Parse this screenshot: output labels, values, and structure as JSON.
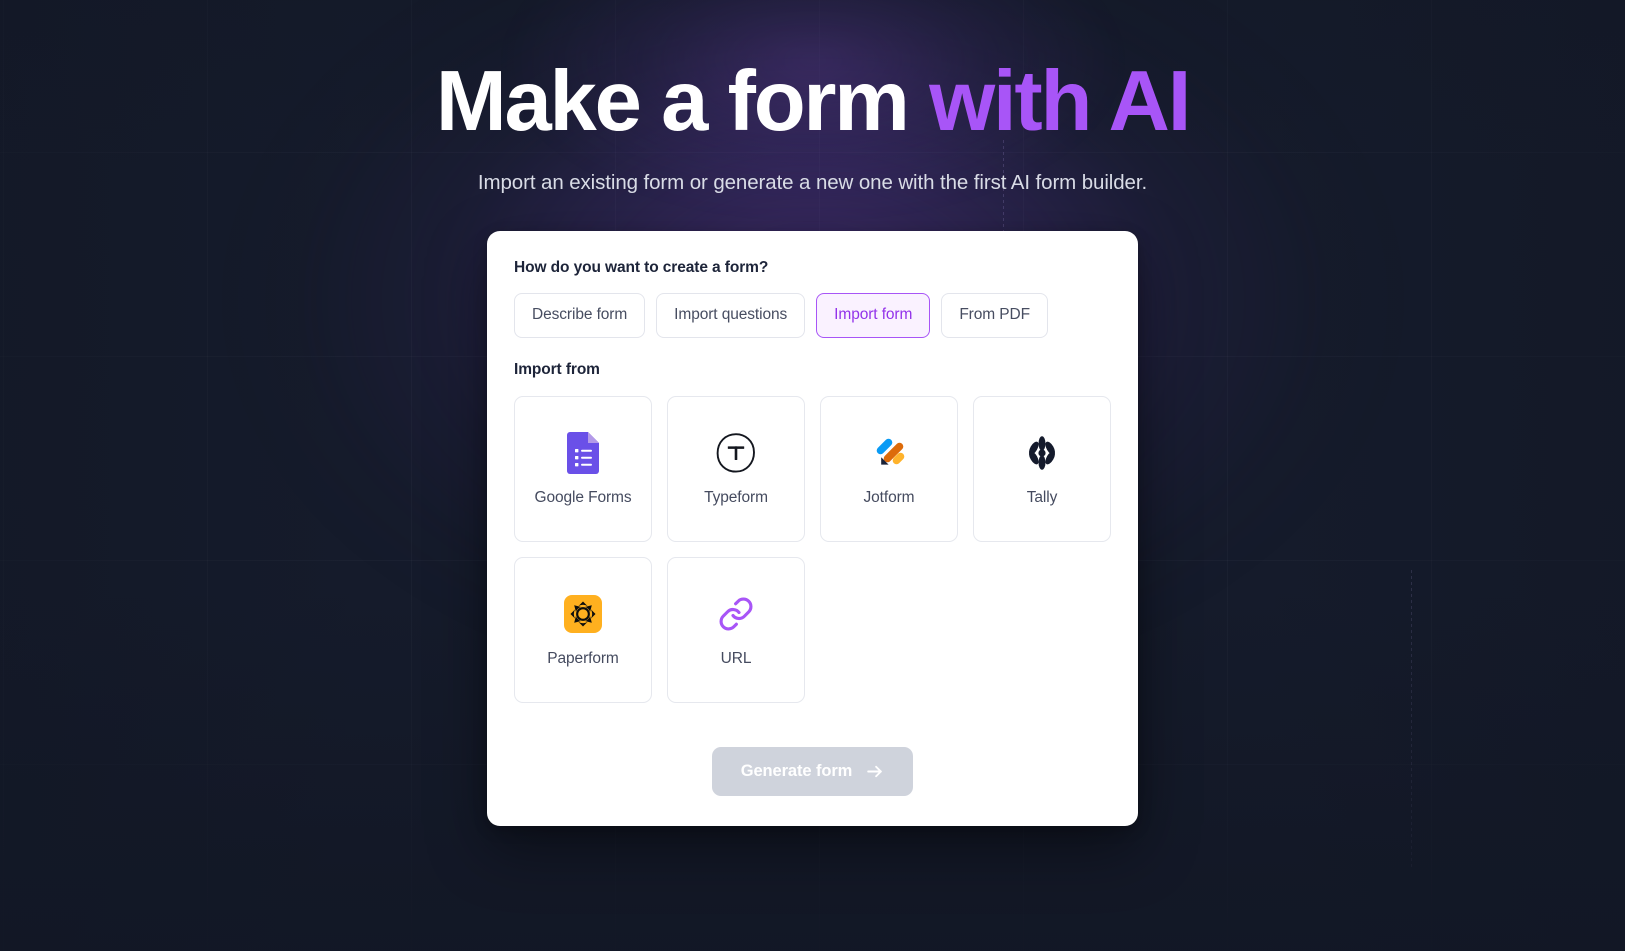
{
  "hero": {
    "headline_prefix": "Make a form ",
    "headline_accent": "with AI",
    "subtitle": "Import an existing form or generate a new one with the first AI form builder."
  },
  "card": {
    "mode_question": "How do you want to create a form?",
    "mode_tabs": [
      {
        "label": "Describe form",
        "selected": false
      },
      {
        "label": "Import questions",
        "selected": false
      },
      {
        "label": "Import form",
        "selected": true
      },
      {
        "label": "From PDF",
        "selected": false
      }
    ],
    "import_from_label": "Import from",
    "providers": [
      {
        "label": "Google Forms",
        "icon": "google-forms-icon"
      },
      {
        "label": "Typeform",
        "icon": "typeform-icon"
      },
      {
        "label": "Jotform",
        "icon": "jotform-icon"
      },
      {
        "label": "Tally",
        "icon": "tally-icon"
      },
      {
        "label": "Paperform",
        "icon": "paperform-icon"
      },
      {
        "label": "URL",
        "icon": "url-link-icon"
      }
    ],
    "generate_button": {
      "label": "Generate form",
      "icon": "arrow-right-icon",
      "disabled": true
    }
  },
  "colors": {
    "page_background": "#151b2b",
    "glow_purple": "#7e46c8",
    "accent_purple": "#a855f7",
    "accent_purple_dark": "#9333ea",
    "card_background": "#ffffff",
    "heading_text": "#1d2439",
    "body_text": "#474d61",
    "subtitle_text": "#d9dce6",
    "selected_tab_background": "#faf2ff",
    "disabled_button_background": "#cfd3dc"
  }
}
